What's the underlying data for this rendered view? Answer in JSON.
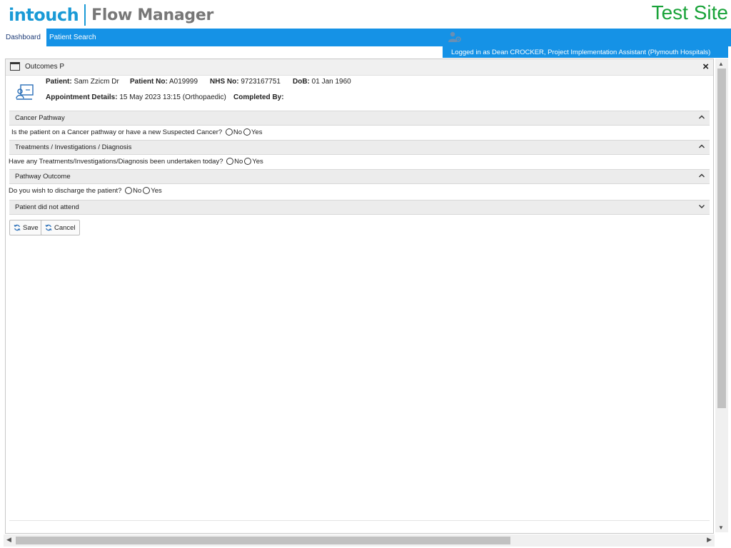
{
  "app": {
    "logo_primary": "intouch",
    "logo_secondary": "Flow Manager",
    "environment": "Test Site",
    "logged_in_text": "Logged in as Dean CROCKER, Project Implementation Assistant (Plymouth Hospitals)"
  },
  "nav": {
    "tabs": [
      {
        "label": "Dashboard",
        "active": true
      },
      {
        "label": "Patient Search",
        "active": false
      }
    ]
  },
  "window": {
    "title": "Outcomes P",
    "close_label": "×"
  },
  "patient": {
    "name_label": "Patient:",
    "name": "Sam Zzicm Dr",
    "patient_no_label": "Patient No:",
    "patient_no": "A019999",
    "nhs_no_label": "NHS No:",
    "nhs_no": "9723167751",
    "dob_label": "DoB:",
    "dob": "01 Jan 1960",
    "appointment_label": "Appointment Details:",
    "appointment": "15 May 2023 13:15 (Orthopaedic)",
    "completed_by_label": "Completed By:",
    "completed_by": ""
  },
  "sections": [
    {
      "title": "Cancer Pathway",
      "expanded": true,
      "question": "Is the patient on a Cancer pathway or have a new Suspected Cancer?",
      "options": [
        "No",
        "Yes"
      ]
    },
    {
      "title": "Treatments / Investigations / Diagnosis",
      "expanded": true,
      "question": "Have any Treatments/Investigations/Diagnosis been undertaken today?",
      "options": [
        "No",
        "Yes"
      ]
    },
    {
      "title": "Pathway Outcome",
      "expanded": true,
      "question": "Do you wish to discharge the patient?",
      "options": [
        "No",
        "Yes"
      ]
    },
    {
      "title": "Patient did not attend",
      "expanded": false
    }
  ],
  "buttons": {
    "save_label": "Save",
    "cancel_label": "Cancel"
  },
  "colors": {
    "brand_blue": "#1592e6",
    "test_site_green": "#1aa33a"
  }
}
